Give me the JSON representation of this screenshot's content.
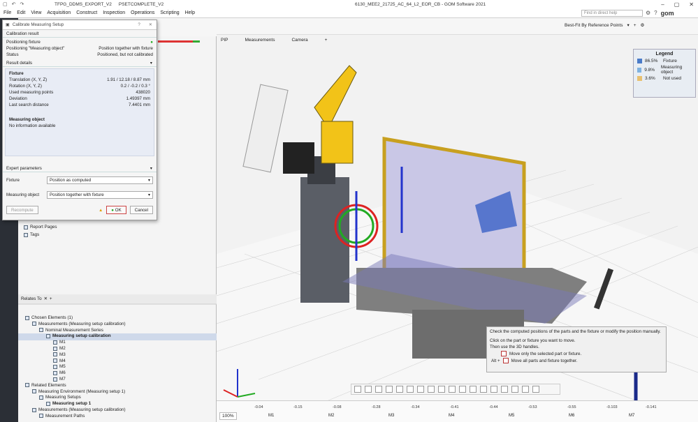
{
  "titlebar": {
    "tabs": [
      "TFPG_DDMS_EXPORT_V2",
      "PSETCOMPLETE_V2"
    ],
    "window_title": "6130_MEE2_21725_AC_64_L2_EOR_CB - GOM Software 2021"
  },
  "menubar": {
    "items": [
      "File",
      "Edit",
      "View",
      "Acquisition",
      "Construct",
      "Inspection",
      "Operations",
      "Scripting",
      "Help"
    ],
    "help_placeholder": "Find in direct help",
    "brand": "gom"
  },
  "dialog": {
    "title": "Calibrate Measuring Setup",
    "calibration_result": {
      "header": "Calibration result",
      "rows": [
        {
          "k": "Positioning fixture",
          "v": ""
        },
        {
          "k": "Positioning \"Measuring object\"",
          "v": "Position together with fixture"
        },
        {
          "k": "Status",
          "v": "Positioned, but not calibrated"
        }
      ]
    },
    "result_details": {
      "header": "Result details",
      "fixture_title": "Fixture",
      "fixture_rows": [
        {
          "k": "Translation (X, Y, Z)",
          "v": "1.91 / 12.18 / 8.87 mm"
        },
        {
          "k": "Rotation (X, Y, Z)",
          "v": "0.2 / -0.2 / 0.3 °"
        },
        {
          "k": "Used measuring points",
          "v": "438020"
        },
        {
          "k": "Deviation",
          "v": "1.49397 mm"
        },
        {
          "k": "Last search distance",
          "v": "7.4401 mm"
        }
      ],
      "object_title": "Measuring object",
      "object_text": "No information available"
    },
    "expert": {
      "header": "Expert parameters",
      "fixture_label": "Fixture",
      "fixture_value": "Position as computed",
      "object_label": "Measuring object",
      "object_value": "Position together with fixture"
    },
    "buttons": {
      "recompute": "Recompute",
      "ok": "OK",
      "cancel": "Cancel"
    }
  },
  "left_panel": {
    "report_pages": "Report Pages",
    "tags": "Tags",
    "relates_to": "Relates To",
    "tree": [
      {
        "label": "Chosen Elements (1)",
        "indent": 0
      },
      {
        "label": "Measurements (Measuring setup calibration)",
        "indent": 1
      },
      {
        "label": "Nominal Measurement Series",
        "indent": 2
      },
      {
        "label": "Measuring setup calibration",
        "indent": 3,
        "bold": true
      },
      {
        "label": "M1",
        "indent": 4
      },
      {
        "label": "M2",
        "indent": 4
      },
      {
        "label": "M3",
        "indent": 4
      },
      {
        "label": "M4",
        "indent": 4
      },
      {
        "label": "M5",
        "indent": 4
      },
      {
        "label": "M6",
        "indent": 4
      },
      {
        "label": "M7",
        "indent": 4
      },
      {
        "label": "Related Elements",
        "indent": 0
      },
      {
        "label": "Measuring Environment (Measuring setup 1)",
        "indent": 1
      },
      {
        "label": "Measuring Setups",
        "indent": 2
      },
      {
        "label": "Measuring setup 1",
        "indent": 3,
        "bold": true
      },
      {
        "label": "Measurements (Measuring setup calibration)",
        "indent": 1
      },
      {
        "label": "Measurement Paths",
        "indent": 2
      }
    ]
  },
  "viewport": {
    "tabs": [
      "PIP",
      "Measurements",
      "Camera"
    ],
    "bestfit_label": "Best-Fit By Reference Points",
    "legend": {
      "title": "Legend",
      "rows": [
        {
          "pct": "86.5%",
          "label": "Fixture",
          "color": "#4a7bc8"
        },
        {
          "pct": "9.8%",
          "label": "Measuring object",
          "color": "#7fb2e0"
        },
        {
          "pct": "3.6%",
          "label": "Not used",
          "color": "#e8c070"
        }
      ]
    },
    "hint": {
      "line1": "Check the computed positions of the parts and the fixture or modify the position manually.",
      "line2": "Click on the part or fixture you want to move.",
      "line3": "Then use the 3D handles.",
      "opt1": "Move only the selected part or fixture.",
      "opt2_key": "Alt +",
      "opt2": "Move all parts and fixture together."
    },
    "zoom": "100%",
    "timeline_marks": [
      "M1",
      "M2",
      "M3",
      "M4",
      "M5",
      "M6",
      "M7"
    ],
    "timeline_ticks": [
      "-0.04",
      "-0.15",
      "-0.08",
      "-0.28",
      "-0.34",
      "-0.41",
      "-0.44",
      "-0.53",
      "-0.55",
      "-0.103",
      "-0.141"
    ]
  }
}
